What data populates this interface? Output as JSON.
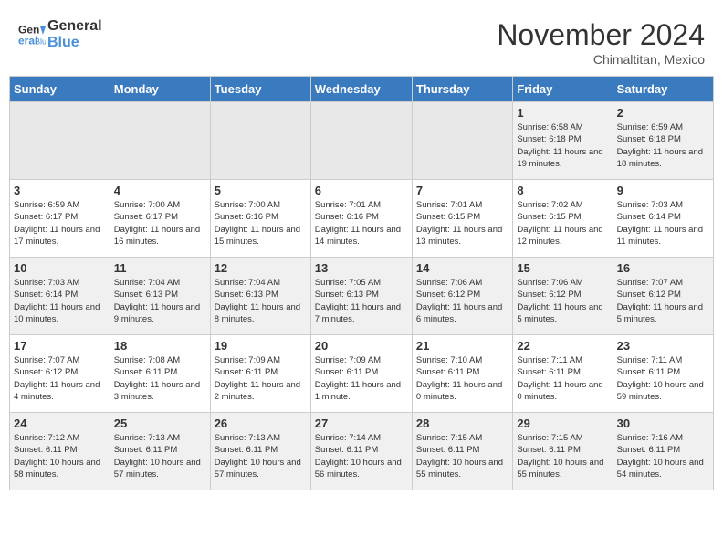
{
  "header": {
    "logo_line1": "General",
    "logo_line2": "Blue",
    "month": "November 2024",
    "location": "Chimaltitan, Mexico"
  },
  "days_of_week": [
    "Sunday",
    "Monday",
    "Tuesday",
    "Wednesday",
    "Thursday",
    "Friday",
    "Saturday"
  ],
  "weeks": [
    [
      {
        "day": "",
        "info": ""
      },
      {
        "day": "",
        "info": ""
      },
      {
        "day": "",
        "info": ""
      },
      {
        "day": "",
        "info": ""
      },
      {
        "day": "",
        "info": ""
      },
      {
        "day": "1",
        "info": "Sunrise: 6:58 AM\nSunset: 6:18 PM\nDaylight: 11 hours and 19 minutes."
      },
      {
        "day": "2",
        "info": "Sunrise: 6:59 AM\nSunset: 6:18 PM\nDaylight: 11 hours and 18 minutes."
      }
    ],
    [
      {
        "day": "3",
        "info": "Sunrise: 6:59 AM\nSunset: 6:17 PM\nDaylight: 11 hours and 17 minutes."
      },
      {
        "day": "4",
        "info": "Sunrise: 7:00 AM\nSunset: 6:17 PM\nDaylight: 11 hours and 16 minutes."
      },
      {
        "day": "5",
        "info": "Sunrise: 7:00 AM\nSunset: 6:16 PM\nDaylight: 11 hours and 15 minutes."
      },
      {
        "day": "6",
        "info": "Sunrise: 7:01 AM\nSunset: 6:16 PM\nDaylight: 11 hours and 14 minutes."
      },
      {
        "day": "7",
        "info": "Sunrise: 7:01 AM\nSunset: 6:15 PM\nDaylight: 11 hours and 13 minutes."
      },
      {
        "day": "8",
        "info": "Sunrise: 7:02 AM\nSunset: 6:15 PM\nDaylight: 11 hours and 12 minutes."
      },
      {
        "day": "9",
        "info": "Sunrise: 7:03 AM\nSunset: 6:14 PM\nDaylight: 11 hours and 11 minutes."
      }
    ],
    [
      {
        "day": "10",
        "info": "Sunrise: 7:03 AM\nSunset: 6:14 PM\nDaylight: 11 hours and 10 minutes."
      },
      {
        "day": "11",
        "info": "Sunrise: 7:04 AM\nSunset: 6:13 PM\nDaylight: 11 hours and 9 minutes."
      },
      {
        "day": "12",
        "info": "Sunrise: 7:04 AM\nSunset: 6:13 PM\nDaylight: 11 hours and 8 minutes."
      },
      {
        "day": "13",
        "info": "Sunrise: 7:05 AM\nSunset: 6:13 PM\nDaylight: 11 hours and 7 minutes."
      },
      {
        "day": "14",
        "info": "Sunrise: 7:06 AM\nSunset: 6:12 PM\nDaylight: 11 hours and 6 minutes."
      },
      {
        "day": "15",
        "info": "Sunrise: 7:06 AM\nSunset: 6:12 PM\nDaylight: 11 hours and 5 minutes."
      },
      {
        "day": "16",
        "info": "Sunrise: 7:07 AM\nSunset: 6:12 PM\nDaylight: 11 hours and 5 minutes."
      }
    ],
    [
      {
        "day": "17",
        "info": "Sunrise: 7:07 AM\nSunset: 6:12 PM\nDaylight: 11 hours and 4 minutes."
      },
      {
        "day": "18",
        "info": "Sunrise: 7:08 AM\nSunset: 6:11 PM\nDaylight: 11 hours and 3 minutes."
      },
      {
        "day": "19",
        "info": "Sunrise: 7:09 AM\nSunset: 6:11 PM\nDaylight: 11 hours and 2 minutes."
      },
      {
        "day": "20",
        "info": "Sunrise: 7:09 AM\nSunset: 6:11 PM\nDaylight: 11 hours and 1 minute."
      },
      {
        "day": "21",
        "info": "Sunrise: 7:10 AM\nSunset: 6:11 PM\nDaylight: 11 hours and 0 minutes."
      },
      {
        "day": "22",
        "info": "Sunrise: 7:11 AM\nSunset: 6:11 PM\nDaylight: 11 hours and 0 minutes."
      },
      {
        "day": "23",
        "info": "Sunrise: 7:11 AM\nSunset: 6:11 PM\nDaylight: 10 hours and 59 minutes."
      }
    ],
    [
      {
        "day": "24",
        "info": "Sunrise: 7:12 AM\nSunset: 6:11 PM\nDaylight: 10 hours and 58 minutes."
      },
      {
        "day": "25",
        "info": "Sunrise: 7:13 AM\nSunset: 6:11 PM\nDaylight: 10 hours and 57 minutes."
      },
      {
        "day": "26",
        "info": "Sunrise: 7:13 AM\nSunset: 6:11 PM\nDaylight: 10 hours and 57 minutes."
      },
      {
        "day": "27",
        "info": "Sunrise: 7:14 AM\nSunset: 6:11 PM\nDaylight: 10 hours and 56 minutes."
      },
      {
        "day": "28",
        "info": "Sunrise: 7:15 AM\nSunset: 6:11 PM\nDaylight: 10 hours and 55 minutes."
      },
      {
        "day": "29",
        "info": "Sunrise: 7:15 AM\nSunset: 6:11 PM\nDaylight: 10 hours and 55 minutes."
      },
      {
        "day": "30",
        "info": "Sunrise: 7:16 AM\nSunset: 6:11 PM\nDaylight: 10 hours and 54 minutes."
      }
    ]
  ]
}
